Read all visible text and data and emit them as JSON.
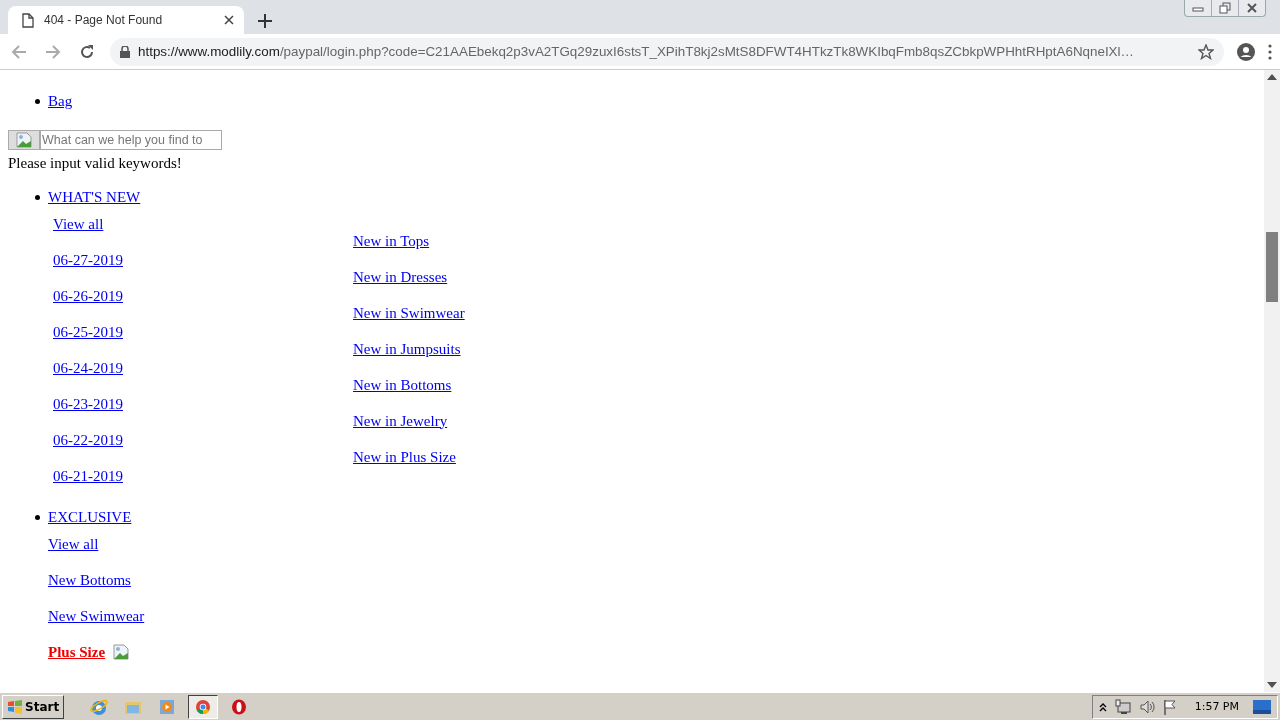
{
  "browser": {
    "tab": {
      "title": "404 - Page Not Found",
      "selected": true
    },
    "url": {
      "host": "https://www.modlily.com",
      "path": "/paypal/login.php?code=C21AAEbekq2p3vA2TGq29zuxI6stsT_XPihT8kj2sMtS8DFWT4HTkzTk8WKIbqFmb8qsZCbkpWPHhtRHptA6NqneIXl…"
    }
  },
  "page": {
    "top_links": [
      "Bag"
    ],
    "search": {
      "placeholder": "What can we help you find to"
    },
    "message": "Please input valid keywords!",
    "menus": [
      {
        "label": "WHAT'S NEW",
        "columns": [
          [
            "View all",
            "06-27-2019",
            "06-26-2019",
            "06-25-2019",
            "06-24-2019",
            "06-23-2019",
            "06-22-2019",
            "06-21-2019"
          ],
          [
            "New in Tops",
            "New in Dresses",
            "New in Swimwear",
            "New in Jumpsuits",
            "New in Bottoms",
            "New in Jewelry",
            "New in Plus Size"
          ]
        ]
      },
      {
        "label": "EXCLUSIVE",
        "items": [
          {
            "label": "View all",
            "kind": "link"
          },
          {
            "label": "New Bottoms",
            "kind": "link"
          },
          {
            "label": "New Swimwear",
            "kind": "link"
          },
          {
            "label": "Plus Size",
            "kind": "sale"
          }
        ]
      }
    ]
  },
  "taskbar": {
    "start": "Start",
    "clock": "1:57 PM"
  }
}
